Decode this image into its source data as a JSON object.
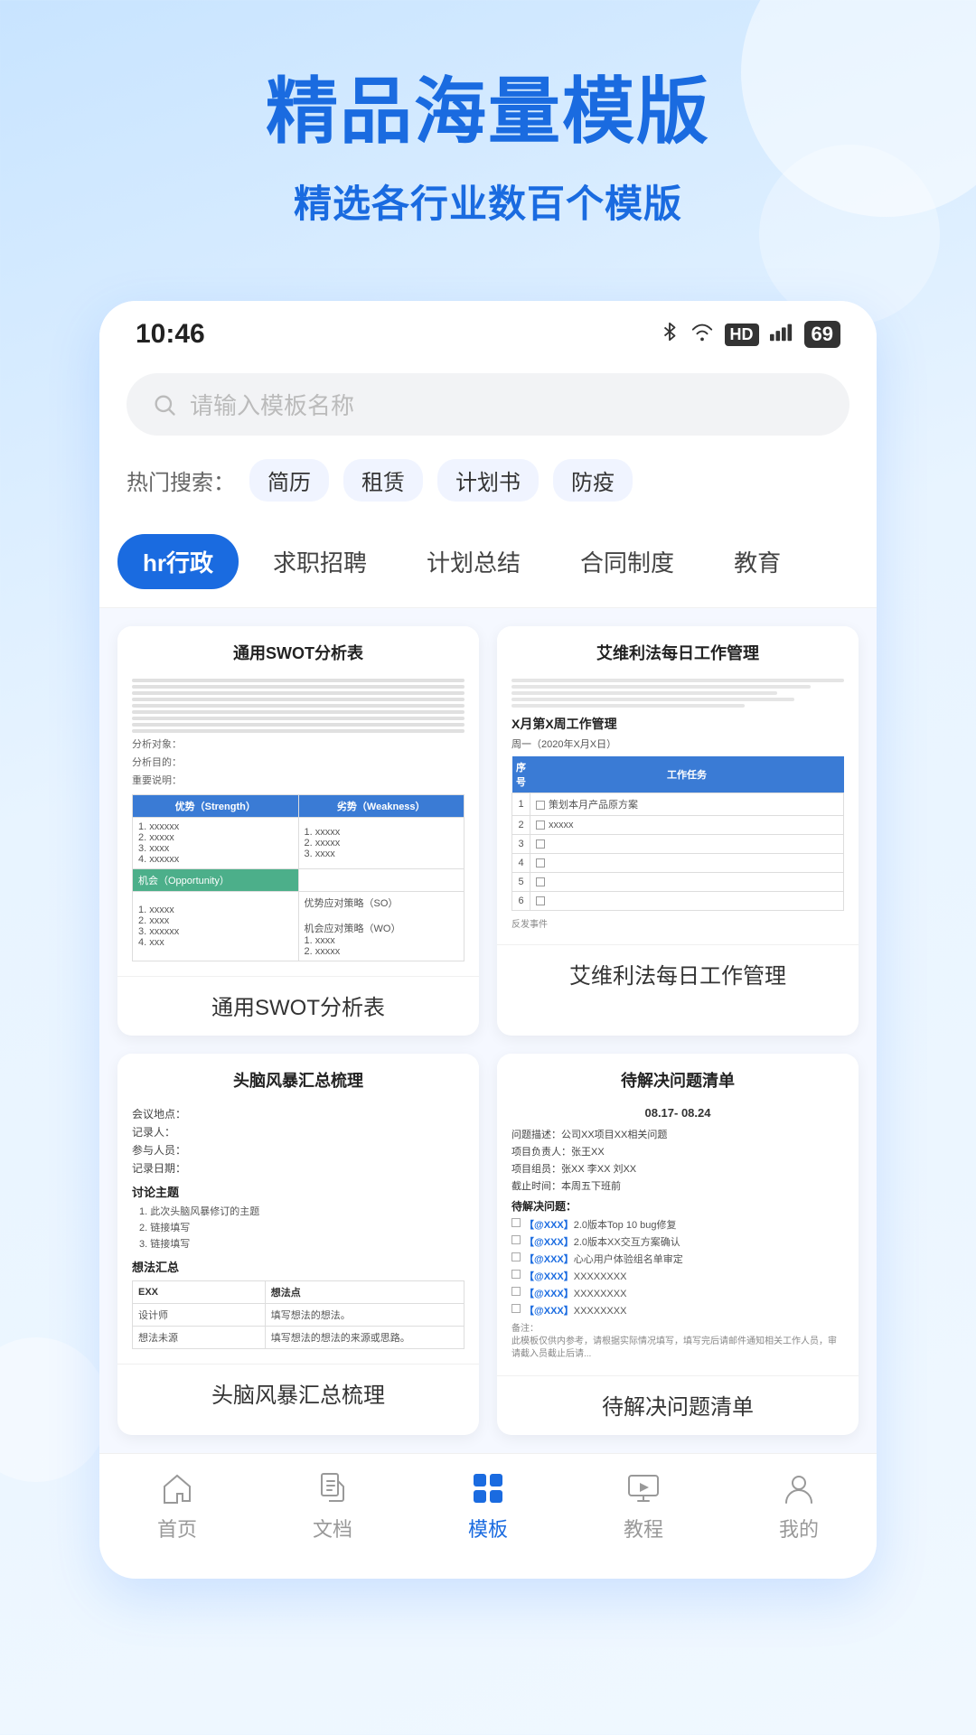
{
  "hero": {
    "title": "精品海量模版",
    "subtitle": "精选各行业数百个模版"
  },
  "status_bar": {
    "time": "10:46",
    "battery": "69"
  },
  "search": {
    "placeholder": "请输入模板名称",
    "hot_label": "热门搜索：",
    "hot_tags": [
      "简历",
      "租赁",
      "计划书",
      "防疫"
    ]
  },
  "categories": [
    {
      "id": "hr",
      "label": "hr行政",
      "active": true
    },
    {
      "id": "job",
      "label": "求职招聘",
      "active": false
    },
    {
      "id": "plan",
      "label": "计划总结",
      "active": false
    },
    {
      "id": "contract",
      "label": "合同制度",
      "active": false
    },
    {
      "id": "edu",
      "label": "教育",
      "active": false
    }
  ],
  "templates": [
    {
      "id": "swot",
      "title": "通用SWOT分析表",
      "label": "通用SWOT分析表"
    },
    {
      "id": "aweili",
      "title": "艾维利法每日工作管理",
      "label": "艾维利法每日工作管理"
    },
    {
      "id": "brainstorm",
      "title": "头脑风暴汇总梳理",
      "label": "头脑风暴汇总梳理"
    },
    {
      "id": "todo",
      "title": "待解决问题清单",
      "label": "待解决问题清单"
    }
  ],
  "bottom_nav": [
    {
      "id": "home",
      "label": "首页",
      "active": false
    },
    {
      "id": "docs",
      "label": "文档",
      "active": false
    },
    {
      "id": "templates",
      "label": "模板",
      "active": true
    },
    {
      "id": "tutorials",
      "label": "教程",
      "active": false
    },
    {
      "id": "mine",
      "label": "我的",
      "active": false
    }
  ]
}
